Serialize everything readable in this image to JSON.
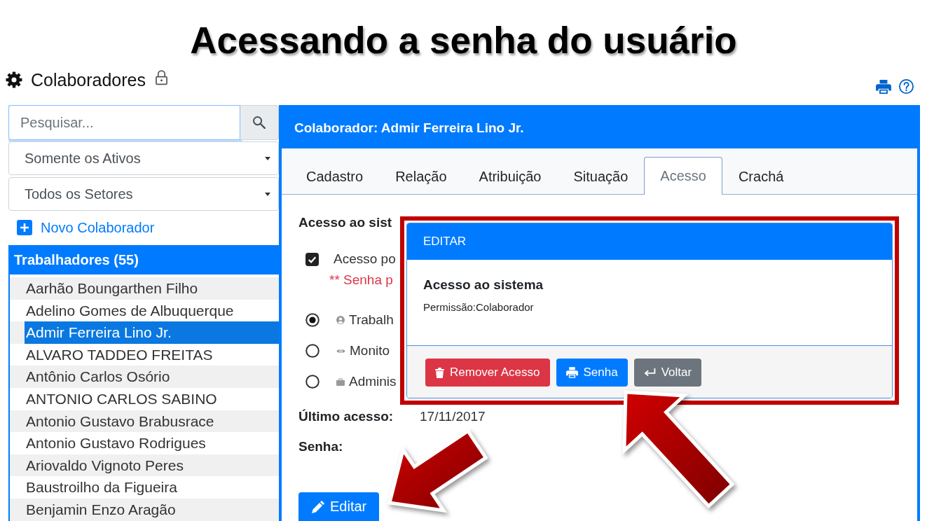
{
  "slide_title": "Acessando a senha do usuário",
  "header": {
    "title": "Colaboradores"
  },
  "sidebar": {
    "search": {
      "placeholder": "Pesquisar...",
      "focused": true
    },
    "filters": [
      {
        "value": "Somente os Ativos"
      },
      {
        "value": "Todos os Setores"
      }
    ],
    "new_link": "Novo Colaborador",
    "list": {
      "title": "Trabalhadores (55)",
      "items": [
        {
          "label": "Aarhão Boungarthen Filho",
          "selected": false
        },
        {
          "label": "Adelino Gomes de Albuquerque",
          "selected": false
        },
        {
          "label": "Admir Ferreira Lino Jr.",
          "selected": true
        },
        {
          "label": "ALVARO TADDEO FREITAS",
          "selected": false
        },
        {
          "label": "Antônio Carlos Osório",
          "selected": false
        },
        {
          "label": "ANTONIO CARLOS SABINO",
          "selected": false
        },
        {
          "label": "Antonio Gustavo Brabusrace",
          "selected": false
        },
        {
          "label": "Antonio Gustavo Rodrigues",
          "selected": false
        },
        {
          "label": "Ariovaldo Vignoto Peres",
          "selected": false
        },
        {
          "label": "Baustroilho da Figueira",
          "selected": false
        },
        {
          "label": "Benjamin Enzo Aragão",
          "selected": false
        }
      ]
    }
  },
  "panel": {
    "title": "Colaborador: Admir Ferreira Lino Jr.",
    "tabs": [
      {
        "label": "Cadastro",
        "selected": false
      },
      {
        "label": "Relação",
        "selected": false
      },
      {
        "label": "Atribuição",
        "selected": false
      },
      {
        "label": "Situação",
        "selected": false
      },
      {
        "label": "Acesso",
        "selected": true
      },
      {
        "label": "Crachá",
        "selected": false
      }
    ],
    "section_title": "Acesso ao sist",
    "access_checkbox": {
      "label": "Acesso po",
      "checked": true
    },
    "note": "** Senha p",
    "roles": [
      {
        "label": "Trabalh",
        "selected": true
      },
      {
        "label": "Monito",
        "selected": false
      },
      {
        "label": "Adminis",
        "selected": false
      }
    ],
    "fields": [
      {
        "label": "Último acesso:",
        "value": "17/11/2017"
      },
      {
        "label": "Senha:"
      }
    ],
    "edit_button": "Editar"
  },
  "dialog": {
    "title": "EDITAR",
    "heading": "Acesso ao sistema",
    "text": "Permissão:Colaborador",
    "buttons": [
      {
        "label": "Remover Acesso",
        "kind": "danger"
      },
      {
        "label": "Senha",
        "kind": "primary"
      },
      {
        "label": "Voltar",
        "kind": "secondary"
      }
    ]
  }
}
